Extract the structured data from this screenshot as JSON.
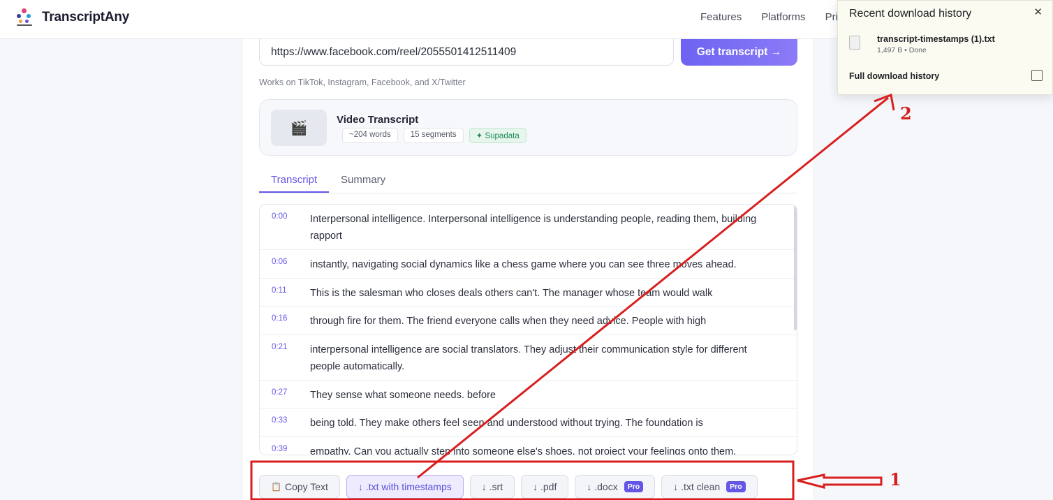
{
  "header": {
    "brand": "TranscriptAny",
    "nav": [
      "Features",
      "Platforms",
      "Pri"
    ]
  },
  "form": {
    "url_value": "https://www.facebook.com/reel/2055501412511409",
    "submit_label": "Get transcript →",
    "works_on": "Works on TikTok, Instagram, Facebook, and X/Twitter"
  },
  "video": {
    "thumb_icon": "clapper-icon",
    "title": "Video Transcript",
    "tags": [
      "~204 words",
      "15 segments",
      "✦ Supadata"
    ]
  },
  "tabs": [
    "Transcript",
    "Summary"
  ],
  "transcript": [
    {
      "time": "0:00",
      "text": "Interpersonal intelligence. Interpersonal intelligence is understanding people, reading them, building rapport"
    },
    {
      "time": "0:06",
      "text": "instantly, navigating social dynamics like a chess game where you can see three moves ahead."
    },
    {
      "time": "0:11",
      "text": "This is the salesman who closes deals others can't. The manager whose team would walk"
    },
    {
      "time": "0:16",
      "text": "through fire for them. The friend everyone calls when they need advice. People with high"
    },
    {
      "time": "0:21",
      "text": "interpersonal intelligence are social translators. They adjust their communication style for different people automatically."
    },
    {
      "time": "0:27",
      "text": "They sense what someone needs. before"
    },
    {
      "time": "0:33",
      "text": "being told. They make others feel seen and understood without trying. The foundation is"
    },
    {
      "time": "0:39",
      "text": "empathy. Can you actually step into someone else's shoes, not project your feelings onto them,"
    }
  ],
  "actions": {
    "copy": "Copy Text",
    "txt_ts": "↓ .txt with timestamps",
    "srt": "↓ .srt",
    "pdf": "↓ .pdf",
    "docx": "↓ .docx",
    "txt_clean": "↓ .txt clean",
    "pro_badge": "Pro"
  },
  "downloads": {
    "title": "Recent download history",
    "file_name": "transcript-timestamps (1).txt",
    "file_meta": "1,497 B • Done",
    "full_history": "Full download history"
  },
  "annotations": {
    "label_1": "1",
    "label_2": "2",
    "color": "#d81e1e"
  }
}
